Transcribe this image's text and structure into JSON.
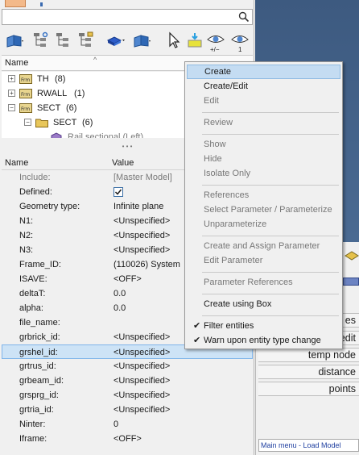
{
  "tree": {
    "header": "Name",
    "items": [
      {
        "label": "TH",
        "count": "(8)"
      },
      {
        "label": "RWALL",
        "count": "(1)"
      },
      {
        "label": "SECT",
        "count": "(6)"
      },
      {
        "label": "SECT",
        "count": "(6)"
      },
      {
        "label": "Rail sectional (Left)",
        "count": ""
      }
    ]
  },
  "properties": {
    "col_name": "Name",
    "col_value": "Value",
    "rows": [
      {
        "name": "Include:",
        "value": "[Master Model]",
        "grey": true
      },
      {
        "name": "Defined:",
        "value": "",
        "checkbox": true
      },
      {
        "name": "Geometry type:",
        "value": "Infinite plane"
      },
      {
        "name": "N1:",
        "value": "<Unspecified>"
      },
      {
        "name": "N2:",
        "value": "<Unspecified>"
      },
      {
        "name": "N3:",
        "value": "<Unspecified>"
      },
      {
        "name": "Frame_ID:",
        "value": "(110026) System"
      },
      {
        "name": "ISAVE:",
        "value": "<OFF>"
      },
      {
        "name": "deltaT:",
        "value": "0.0"
      },
      {
        "name": "alpha:",
        "value": "0.0"
      },
      {
        "name": "file_name:",
        "value": ""
      },
      {
        "name": "grbrick_id:",
        "value": "<Unspecified>"
      },
      {
        "name": "grshel_id:",
        "value": "<Unspecified>",
        "selected": true
      },
      {
        "name": "grtrus_id:",
        "value": "<Unspecified>"
      },
      {
        "name": "grbeam_id:",
        "value": "<Unspecified>"
      },
      {
        "name": "grsprg_id:",
        "value": "<Unspecified>"
      },
      {
        "name": "grtria_id:",
        "value": "<Unspecified>"
      },
      {
        "name": "Ninter:",
        "value": "0"
      },
      {
        "name": "Iframe:",
        "value": "<OFF>"
      }
    ]
  },
  "toolbar": {
    "plusminus_label": "+/−",
    "one_label": "1"
  },
  "context_menu": {
    "items": [
      {
        "label": "Create",
        "state": "highlight"
      },
      {
        "label": "Create/Edit",
        "state": "normal"
      },
      {
        "label": "Edit",
        "state": "disabled"
      },
      {
        "label": "Review",
        "state": "disabled"
      },
      {
        "label": "Show",
        "state": "disabled"
      },
      {
        "label": "Hide",
        "state": "disabled"
      },
      {
        "label": "Isolate Only",
        "state": "disabled"
      },
      {
        "label": "References",
        "state": "disabled"
      },
      {
        "label": "Select Parameter / Parameterize",
        "state": "disabled"
      },
      {
        "label": "Unparameterize",
        "state": "disabled"
      },
      {
        "label": "Create and Assign Parameter",
        "state": "disabled"
      },
      {
        "label": "Edit Parameter",
        "state": "disabled"
      },
      {
        "label": "Parameter References",
        "state": "disabled"
      },
      {
        "label": "Create using Box",
        "state": "normal"
      },
      {
        "label": "Filter entities",
        "state": "checked"
      },
      {
        "label": "Warn upon entity type change",
        "state": "checked"
      }
    ]
  },
  "right_panel": {
    "buttons": [
      "es",
      "edit",
      "temp node",
      "distance",
      "points"
    ],
    "bottom_text": "Main menu - Load Model"
  },
  "colors": {
    "selection": "#cde3f6",
    "menu_highlight": "#c4dcf2",
    "viewport": "#3f5b7e"
  }
}
